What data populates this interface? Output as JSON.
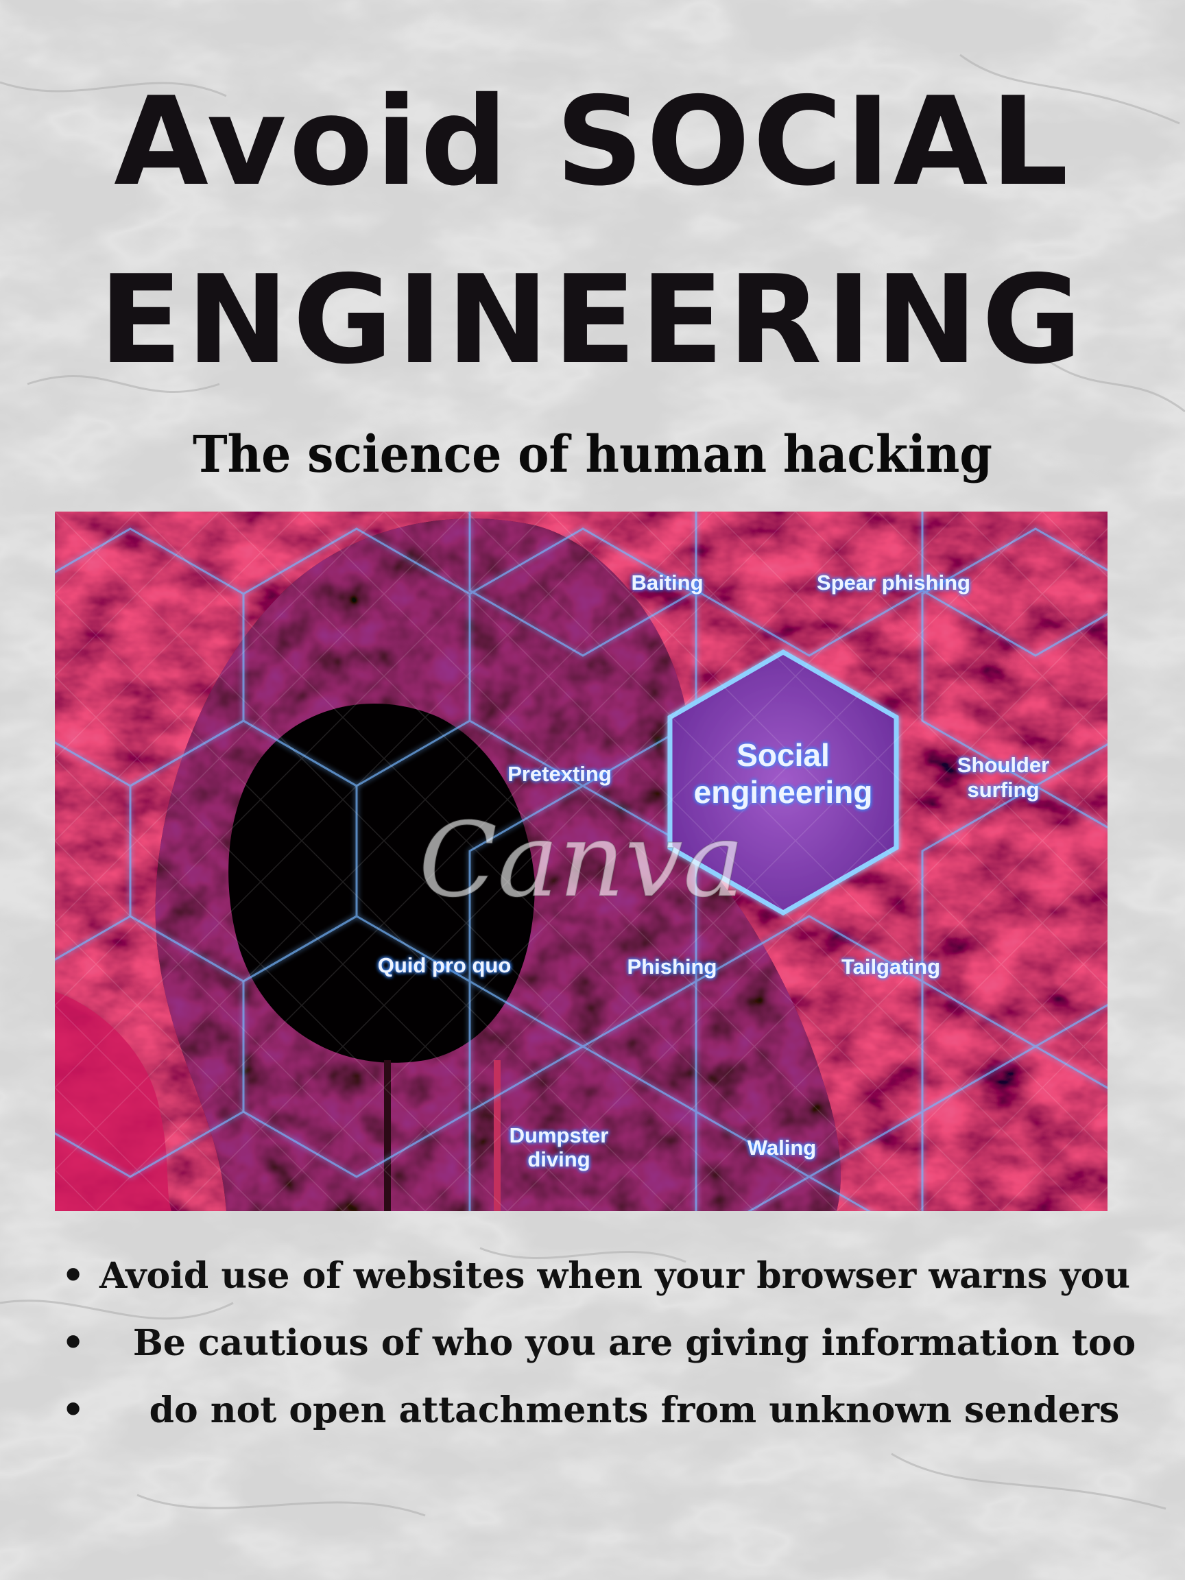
{
  "poster": {
    "title_line_1": "Avoid SOCIAL",
    "title_line_2": "ENGINEERING",
    "subtitle": "The science of human hacking"
  },
  "image": {
    "center_label_line_1": "Social",
    "center_label_line_2": "engineering",
    "labels": {
      "baiting": "Baiting",
      "spear_phishing": "Spear phishing",
      "pretexting": "Pretexting",
      "shoulder_surfing_1": "Shoulder",
      "shoulder_surfing_2": "surfing",
      "quid_pro_quo": "Quid pro quo",
      "phishing": "Phishing",
      "tailgating": "Tailgating",
      "dumpster_diving_1": "Dumpster",
      "dumpster_diving_2": "diving",
      "waling": "Waling"
    },
    "watermark": "Canva"
  },
  "tips": [
    "Avoid use of websites when your browser warns you",
    "Be cautious of who you are giving information too",
    "do not open attachments from unknown senders"
  ],
  "colors": {
    "title": "#141014",
    "hex_glow": "#6fb6ff",
    "fire_red": "#c2122c",
    "hood_pink": "#ff2a7a"
  }
}
